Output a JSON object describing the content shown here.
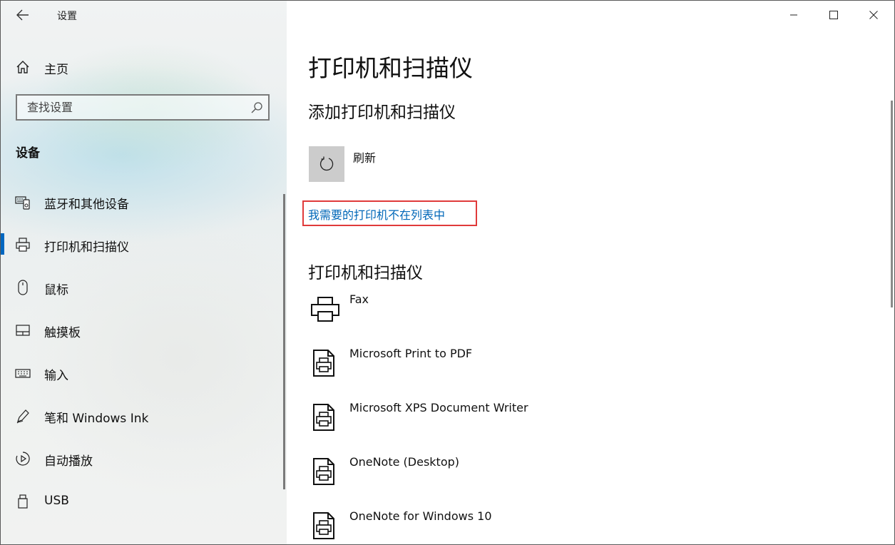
{
  "window": {
    "title": "设置",
    "back_icon": "back-arrow-icon",
    "controls": [
      "minimize-icon",
      "maximize-icon",
      "close-icon"
    ]
  },
  "sidebar": {
    "home_label": "主页",
    "search_placeholder": "查找设置",
    "section_label": "设备",
    "items": [
      {
        "label": "蓝牙和其他设备",
        "icon": "bluetooth-devices-icon",
        "selected": false
      },
      {
        "label": "打印机和扫描仪",
        "icon": "printer-icon",
        "selected": true
      },
      {
        "label": "鼠标",
        "icon": "mouse-icon",
        "selected": false
      },
      {
        "label": "触摸板",
        "icon": "touchpad-icon",
        "selected": false
      },
      {
        "label": "输入",
        "icon": "keyboard-icon",
        "selected": false
      },
      {
        "label": "笔和 Windows Ink",
        "icon": "pen-icon",
        "selected": false
      },
      {
        "label": "自动播放",
        "icon": "autoplay-icon",
        "selected": false
      },
      {
        "label": "USB",
        "icon": "usb-icon",
        "selected": false
      }
    ]
  },
  "main": {
    "page_title": "打印机和扫描仪",
    "add_section_title": "添加打印机和扫描仪",
    "refresh_label": "刷新",
    "not_listed_link": "我需要的打印机不在列表中",
    "list_title": "打印机和扫描仪",
    "printers": [
      {
        "name": "Fax",
        "icon": "fax-printer-icon"
      },
      {
        "name": "Microsoft Print to PDF",
        "icon": "document-printer-icon"
      },
      {
        "name": "Microsoft XPS Document Writer",
        "icon": "document-printer-icon"
      },
      {
        "name": "OneNote (Desktop)",
        "icon": "document-printer-icon"
      },
      {
        "name": "OneNote for Windows 10",
        "icon": "document-printer-icon"
      }
    ]
  },
  "colors": {
    "accent": "#0067c0",
    "link": "#0067b8",
    "highlight_box": "#e03a3a",
    "refresh_button_bg": "#cccccc"
  }
}
